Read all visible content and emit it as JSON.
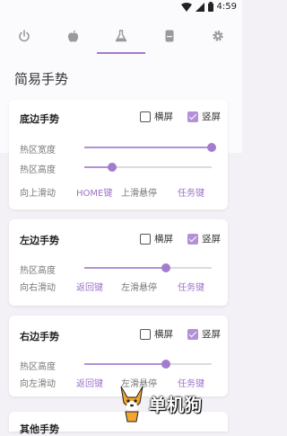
{
  "status_bar": {
    "time": "4:59"
  },
  "tabs": [
    {
      "name": "tab-power",
      "icon": "power-icon"
    },
    {
      "name": "tab-apple",
      "icon": "apple-icon"
    },
    {
      "name": "tab-flask",
      "icon": "flask-icon",
      "active": true
    },
    {
      "name": "tab-device",
      "icon": "phone-icon"
    },
    {
      "name": "tab-settings",
      "icon": "gear-icon"
    }
  ],
  "page_title": "简易手势",
  "cards": {
    "bottom": {
      "title": "底边手势",
      "landscape_label": "横屏",
      "portrait_label": "竖屏",
      "landscape_checked": false,
      "portrait_checked": true,
      "width_label": "热区宽度",
      "width_value": 1.0,
      "height_label": "热区高度",
      "height_value": 0.22,
      "swipe_label": "向上滑动",
      "swipe_action": "HOME键",
      "hold_label": "上滑悬停",
      "hold_action": "任务键"
    },
    "left": {
      "title": "左边手势",
      "landscape_label": "横屏",
      "portrait_label": "竖屏",
      "landscape_checked": false,
      "portrait_checked": true,
      "height_label": "热区高度",
      "height_value": 0.64,
      "swipe_label": "向右滑动",
      "swipe_action": "返回键",
      "hold_label": "左滑悬停",
      "hold_action": "任务键"
    },
    "right": {
      "title": "右边手势",
      "landscape_label": "横屏",
      "portrait_label": "竖屏",
      "landscape_checked": false,
      "portrait_checked": true,
      "height_label": "热区高度",
      "height_value": 0.64,
      "swipe_label": "向左滑动",
      "swipe_action": "返回键",
      "hold_label": "左滑悬停",
      "hold_action": "任务键"
    },
    "next": {
      "title": "其他手势"
    }
  },
  "watermark": {
    "text": "单机狗"
  },
  "colors": {
    "accent": "#b490d8",
    "accent_dark": "#9b73c8",
    "background": "#f3f1f6"
  }
}
